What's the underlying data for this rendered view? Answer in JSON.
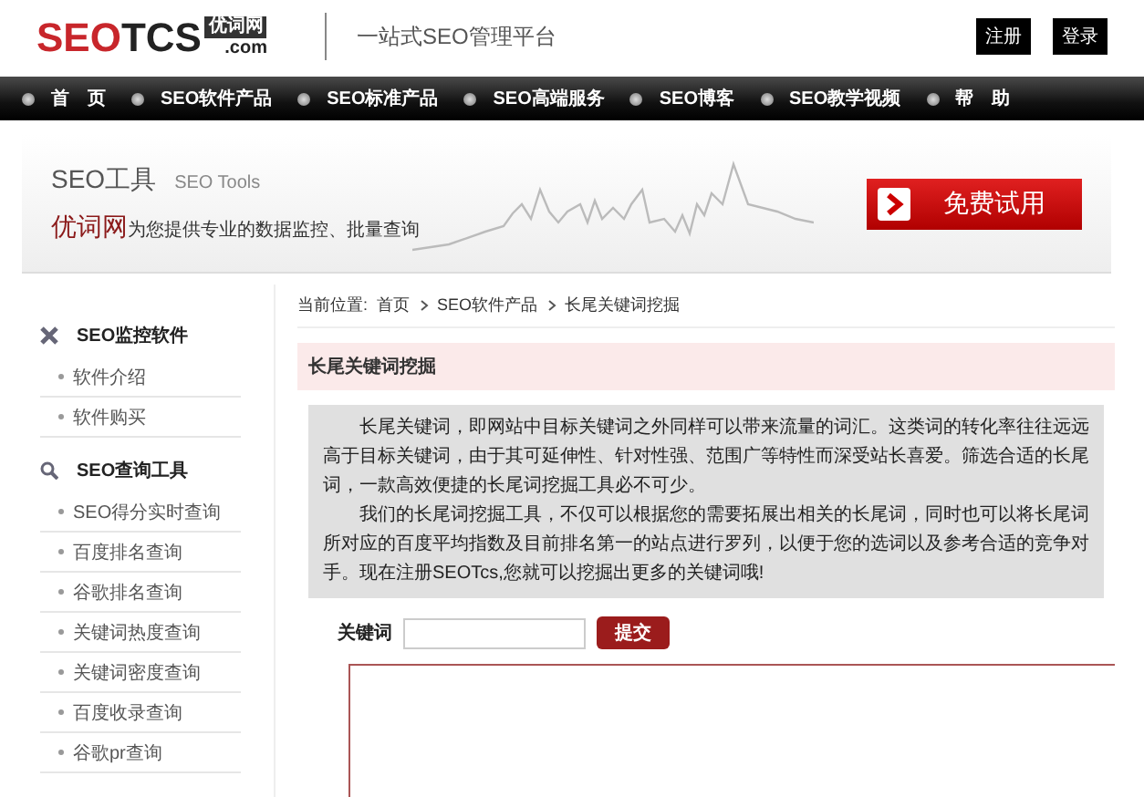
{
  "header": {
    "logo": {
      "red": "SEO",
      "dark": "TCS",
      "badge": "优词网",
      "domain": ".com"
    },
    "tagline": "一站式SEO管理平台",
    "buttons": [
      "注册",
      "登录"
    ]
  },
  "nav": [
    "首　页",
    "SEO软件产品",
    "SEO标准产品",
    "SEO高端服务",
    "SEO博客",
    "SEO教学视频",
    "帮　助"
  ],
  "banner": {
    "title": "SEO工具",
    "subtitle": "SEO Tools",
    "brand": "优词网",
    "slogan": "为您提供专业的数据监控、批量查询",
    "cta": "免费试用"
  },
  "sidebar": [
    {
      "title": "SEO监控软件",
      "kind": "monitor",
      "items": [
        "软件介绍",
        "软件购买"
      ]
    },
    {
      "title": "SEO查询工具",
      "kind": "search",
      "items": [
        "SEO得分实时查询",
        "百度排名查询",
        "谷歌排名查询",
        "关键词热度查询",
        "关键词密度查询",
        "百度收录查询",
        "谷歌pr查询"
      ]
    }
  ],
  "breadcrumb": {
    "label": "当前位置:",
    "items": [
      "首页",
      "SEO软件产品",
      "长尾关键词挖掘"
    ]
  },
  "panel": {
    "title": "长尾关键词挖掘",
    "paragraphs": [
      "长尾关键词，即网站中目标关键词之外同样可以带来流量的词汇。这类词的转化率往往远远高于目标关键词，由于其可延伸性、针对性强、范围广等特性而深受站长喜爱。筛选合适的长尾词，一款高效便捷的长尾词挖掘工具必不可少。",
      "我们的长尾词挖掘工具，不仅可以根据您的需要拓展出相关的长尾词，同时也可以将长尾词所对应的百度平均指数及目前排名第一的站点进行罗列，以便于您的选词以及参考合适的竞争对手。现在注册SEOTcs,您就可以挖掘出更多的关键词哦!"
    ],
    "form": {
      "label": "关键词",
      "submit": "提交"
    }
  }
}
